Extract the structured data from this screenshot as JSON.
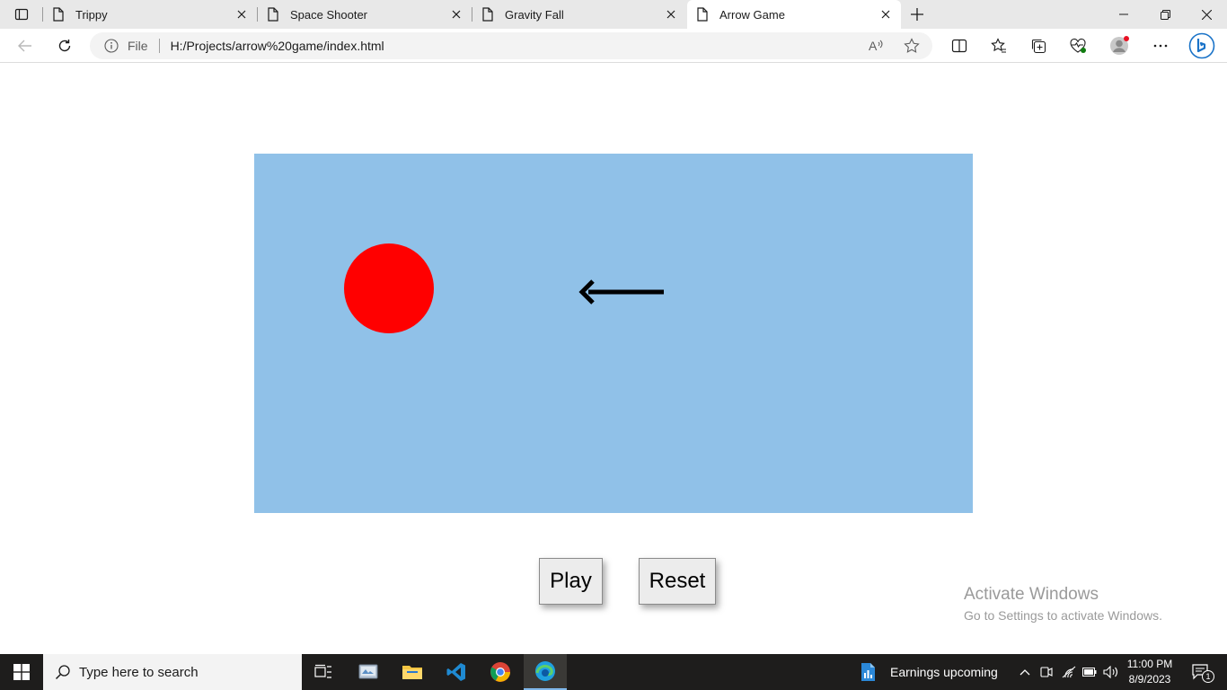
{
  "browser": {
    "tabs": [
      {
        "title": "Trippy",
        "active": false
      },
      {
        "title": "Space Shooter",
        "active": false
      },
      {
        "title": "Gravity Fall",
        "active": false
      },
      {
        "title": "Arrow Game",
        "active": true
      }
    ],
    "address": {
      "scheme_label": "File",
      "url": "H:/Projects/arrow%20game/index.html"
    }
  },
  "page": {
    "canvas_color": "#90c1e8",
    "ball_color": "#ff0000",
    "play_label": "Play",
    "reset_label": "Reset"
  },
  "watermark": {
    "title": "Activate Windows",
    "subtitle": "Go to Settings to activate Windows."
  },
  "taskbar": {
    "search_placeholder": "Type here to search",
    "news_text": "Earnings upcoming",
    "time": "11:00 PM",
    "date": "8/9/2023",
    "notification_count": "1"
  }
}
